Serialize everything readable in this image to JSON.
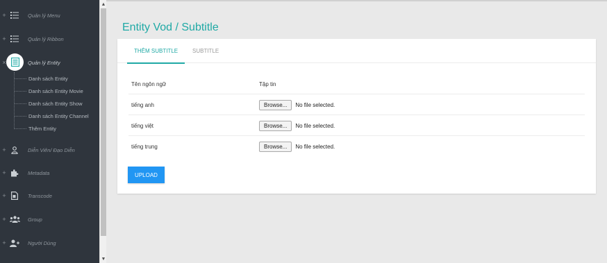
{
  "sidebar": {
    "items": [
      {
        "label": "Quản lý Menu",
        "toggle": "+",
        "icon": "list-icon"
      },
      {
        "label": "Quản lý Ribbon",
        "toggle": "+",
        "icon": "list-icon"
      },
      {
        "label": "Quản lý Entity",
        "toggle": "×",
        "icon": "document-list-icon"
      },
      {
        "label": "Diễn Viên/ Đạo Diễn",
        "toggle": "+",
        "icon": "person-icon"
      },
      {
        "label": "Metadata",
        "toggle": "+",
        "icon": "puzzle-icon"
      },
      {
        "label": "Transcode",
        "toggle": "+",
        "icon": "file-icon"
      },
      {
        "label": "Group",
        "toggle": "+",
        "icon": "group-icon"
      },
      {
        "label": "Người Dùng",
        "toggle": "+",
        "icon": "user-add-icon"
      }
    ],
    "submenu": [
      {
        "label": "Danh sách Entity"
      },
      {
        "label": "Danh sách Entity Movie"
      },
      {
        "label": "Danh sách Entity Show"
      },
      {
        "label": "Danh sách Entity Channel"
      },
      {
        "label": "Thêm Entity"
      }
    ]
  },
  "page": {
    "title": "Entity Vod / Subtitle"
  },
  "tabs": [
    {
      "label": "THÊM SUBTITLE",
      "active": true
    },
    {
      "label": "SUBTITLE",
      "active": false
    }
  ],
  "table": {
    "headers": {
      "language": "Tên ngôn ngữ",
      "file": "Tập tin"
    },
    "rows": [
      {
        "language": "tiếng anh",
        "browse_label": "Browse...",
        "file_status": "No file selected."
      },
      {
        "language": "tiếng việt",
        "browse_label": "Browse...",
        "file_status": "No file selected."
      },
      {
        "language": "tiếng trung",
        "browse_label": "Browse...",
        "file_status": "No file selected."
      }
    ]
  },
  "actions": {
    "upload_label": "UPLOAD"
  },
  "colors": {
    "accent": "#1fa9a5",
    "primary_button": "#2196f3",
    "sidebar_bg": "#2f353d"
  }
}
